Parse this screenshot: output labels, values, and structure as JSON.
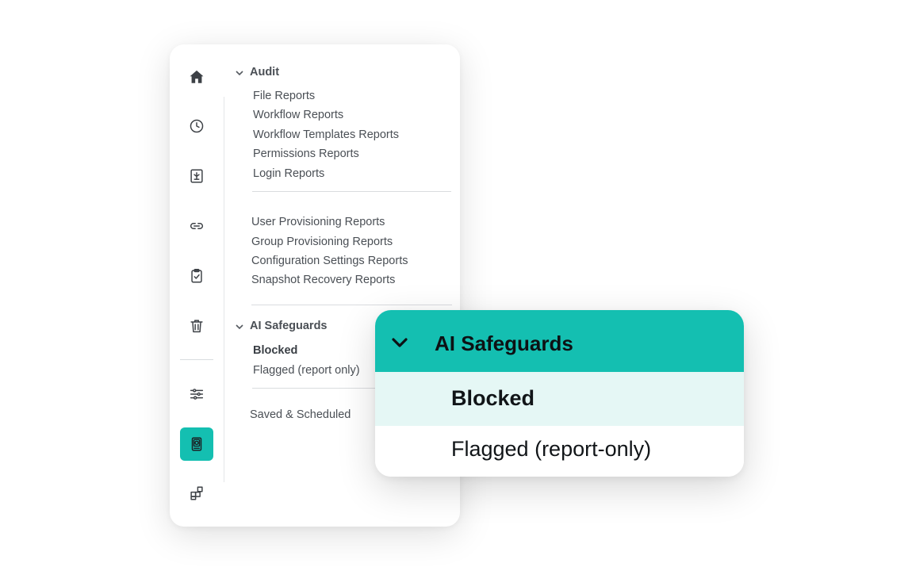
{
  "rail": {
    "icons": [
      "home-icon",
      "history-icon",
      "reports-icon",
      "link-icon",
      "clipboard-check-icon",
      "trash-icon",
      "sliders-icon",
      "ai-safeguards-icon",
      "apps-icon"
    ],
    "active": "ai-safeguards-icon",
    "accent_color": "#14bfb1"
  },
  "audit": {
    "label": "Audit",
    "items": [
      "File Reports",
      "Workflow Reports",
      "Workflow Templates Reports",
      "Permissions Reports",
      "Login Reports"
    ]
  },
  "admin": {
    "items": [
      "User Provisioning Reports",
      "Group Provisioning Reports",
      "Configuration Settings Reports",
      "Snapshot Recovery Reports"
    ]
  },
  "ai_safeguards": {
    "label": "AI Safeguards",
    "items": [
      "Blocked",
      "Flagged (report only)"
    ]
  },
  "saved": {
    "label": "Saved & Scheduled"
  },
  "popup": {
    "title": "AI Safeguards",
    "items": [
      "Blocked",
      "Flagged (report-only)"
    ],
    "header_color": "#14bfb1",
    "selected_color": "#e5f7f5"
  }
}
